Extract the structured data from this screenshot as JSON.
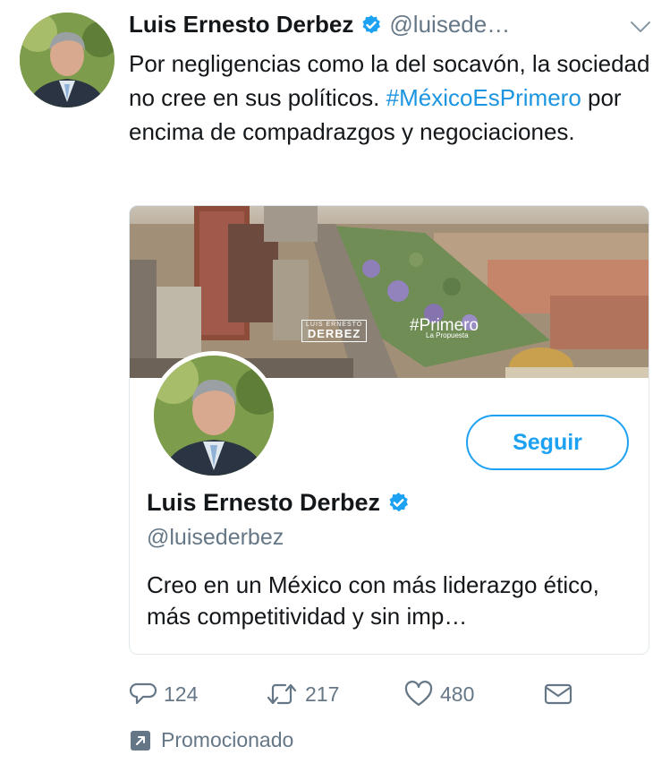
{
  "tweet": {
    "author_name": "Luis Ernesto Derbez",
    "author_handle": "@luisede…",
    "text_before_hashtag": "Por negligencias como la del socavón, la sociedad no cree en sus políticos. ",
    "hashtag": "#MéxicoEsPrimero",
    "text_after_hashtag": " por encima de compadrazgos y negociaciones."
  },
  "card": {
    "banner_logo_line1": "LUIS ERNESTO",
    "banner_logo_line2": "DERBEZ",
    "banner_tag_line1": "#Primero",
    "banner_tag_line2": "La Propuesta",
    "follow_label": "Seguir",
    "name": "Luis Ernesto Derbez",
    "handle": "@luisederbez",
    "bio": "Creo en un México con más liderazgo ético, más competitividad y sin imp…"
  },
  "actions": {
    "replies": "124",
    "retweets": "217",
    "likes": "480"
  },
  "promoted_label": "Promocionado",
  "icons": {
    "verified": "verified-badge-icon",
    "caret": "chevron-down-icon",
    "reply": "reply-icon",
    "retweet": "retweet-icon",
    "like": "heart-icon",
    "message": "envelope-icon",
    "promoted": "promoted-arrow-icon"
  },
  "colors": {
    "link": "#1b95e0",
    "accent": "#1da1f2",
    "secondary_text": "#657786",
    "border": "#e1e8ed"
  }
}
